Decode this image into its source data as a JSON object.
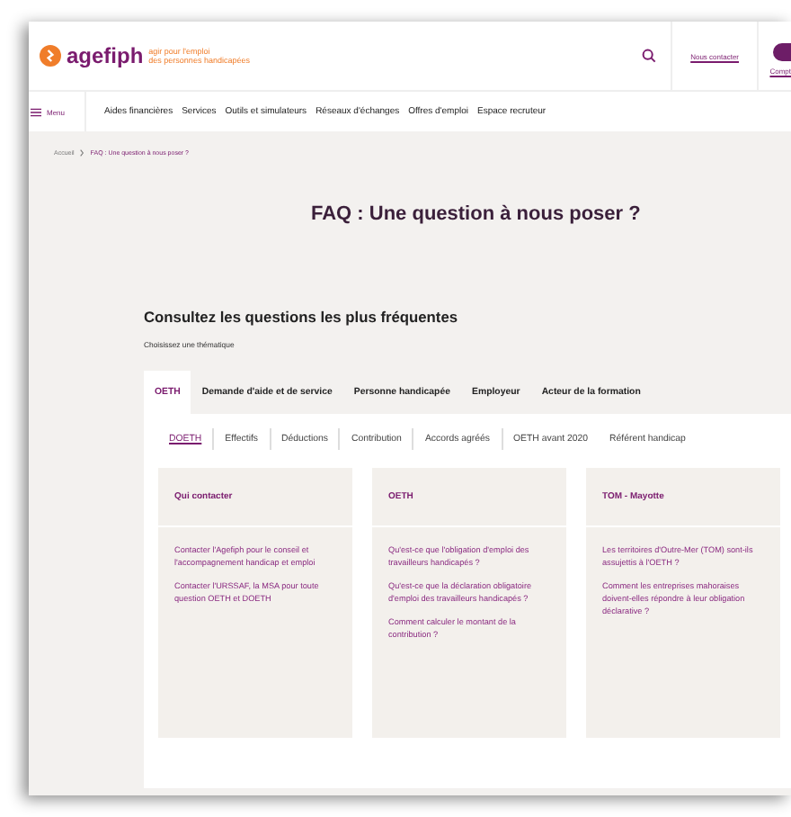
{
  "header": {
    "logo": {
      "name": "agefiph",
      "tagline": [
        "agir pour l'emploi",
        "des personnes handicapées"
      ]
    },
    "contact_link": "Nous contacter",
    "account_label": "Compt"
  },
  "nav": {
    "menu_label": "Menu",
    "items": [
      "Aides financières",
      "Services",
      "Outils et simulateurs",
      "Réseaux d'échanges",
      "Offres d'emploi",
      "Espace recruteur"
    ]
  },
  "breadcrumb": [
    "Accueil",
    "FAQ : Une question à nous poser ?"
  ],
  "page_title": "FAQ : Une question à nous poser ?",
  "section": {
    "heading": "Consultez les questions les plus fréquentes",
    "subheading": "Choisissez une thématique"
  },
  "tabs": [
    {
      "label": "OETH",
      "selected": true
    },
    {
      "label": "Demande d'aide et de service",
      "selected": false
    },
    {
      "label": "Personne handicapée",
      "selected": false
    },
    {
      "label": "Employeur",
      "selected": false
    },
    {
      "label": "Acteur de la formation",
      "selected": false
    }
  ],
  "subtabs": [
    {
      "label": "DOETH",
      "selected": true
    },
    {
      "label": "Effectifs",
      "selected": false
    },
    {
      "label": "Déductions",
      "selected": false
    },
    {
      "label": "Contribution",
      "selected": false
    },
    {
      "label": "Accords agréés",
      "selected": false
    },
    {
      "label": "OETH avant 2020",
      "selected": false
    },
    {
      "label": "Référent handicap",
      "selected": false
    }
  ],
  "cards": [
    {
      "title": "Qui contacter",
      "links": [
        "Contacter l'Agefiph pour le conseil et l'accompagnement handicap et emploi",
        "Contacter l'URSSAF, la MSA pour toute question OETH et DOETH"
      ]
    },
    {
      "title": "OETH",
      "links": [
        "Qu'est-ce que l'obligation d'emploi des travailleurs handicapés ?",
        "Qu'est-ce que la déclaration obligatoire d'emploi des travailleurs handicapés ?",
        "Comment calculer le montant de la contribution ?"
      ]
    },
    {
      "title": "TOM - Mayotte",
      "links": [
        "Les territoires d'Outre-Mer (TOM) sont-ils assujettis à l'OETH ?",
        "Comment les entreprises mahoraises doivent-elles répondre à leur obligation déclarative ?"
      ]
    }
  ]
}
